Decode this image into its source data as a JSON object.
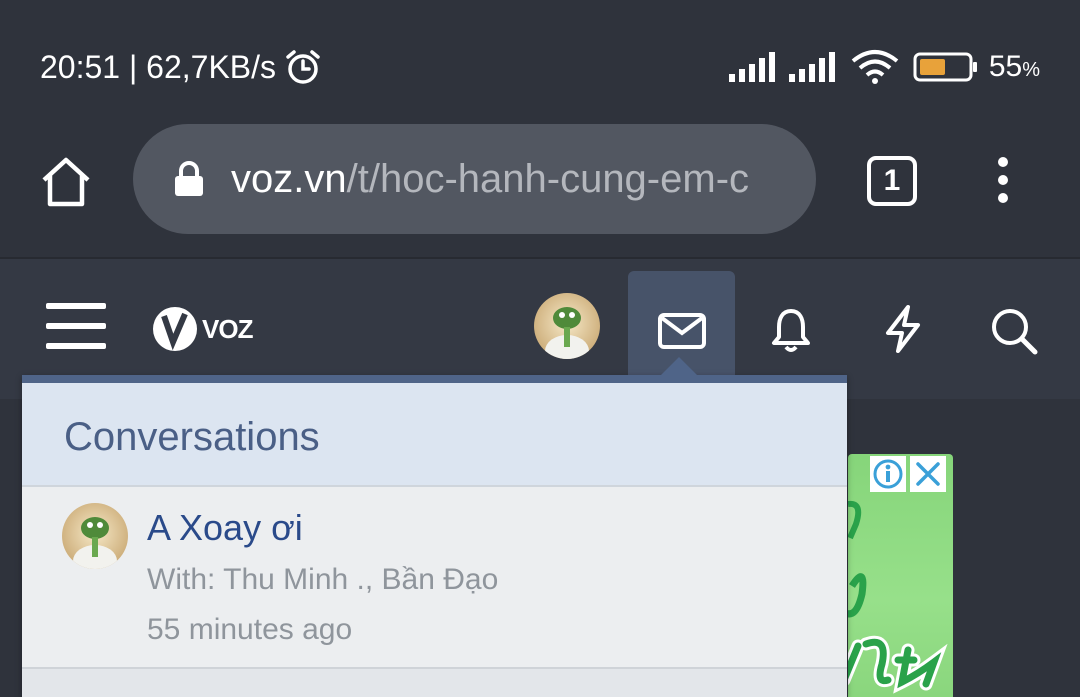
{
  "status_bar": {
    "time_and_speed": "20:51 | 62,7KB/s",
    "battery_percent": "55",
    "battery_percent_sign": "%",
    "battery_level": 0.55,
    "battery_color": "#e8a23a"
  },
  "browser": {
    "url_domain": "voz.vn",
    "url_path": "/t/hoc-hanh-cung-em-c",
    "tab_count": "1"
  },
  "site": {
    "logo_text": "VOZ"
  },
  "dropdown": {
    "title": "Conversations",
    "items": [
      {
        "title": "A Xoay ơi",
        "participants": "With: Thu Minh ., Bần Đạo",
        "time": "55 minutes ago"
      }
    ]
  },
  "colors": {
    "accent": "#4f6488",
    "header_bg": "#343944",
    "dropdown_header_bg": "#dce5f1",
    "link": "#2a4a8a"
  },
  "icons": [
    "alarm-icon",
    "signal-icon",
    "wifi-icon",
    "battery-icon",
    "home-icon",
    "lock-icon",
    "tabs-icon",
    "overflow-menu-icon",
    "hamburger-icon",
    "envelope-icon",
    "bell-icon",
    "bolt-icon",
    "search-icon",
    "ad-info-icon",
    "ad-close-icon"
  ]
}
